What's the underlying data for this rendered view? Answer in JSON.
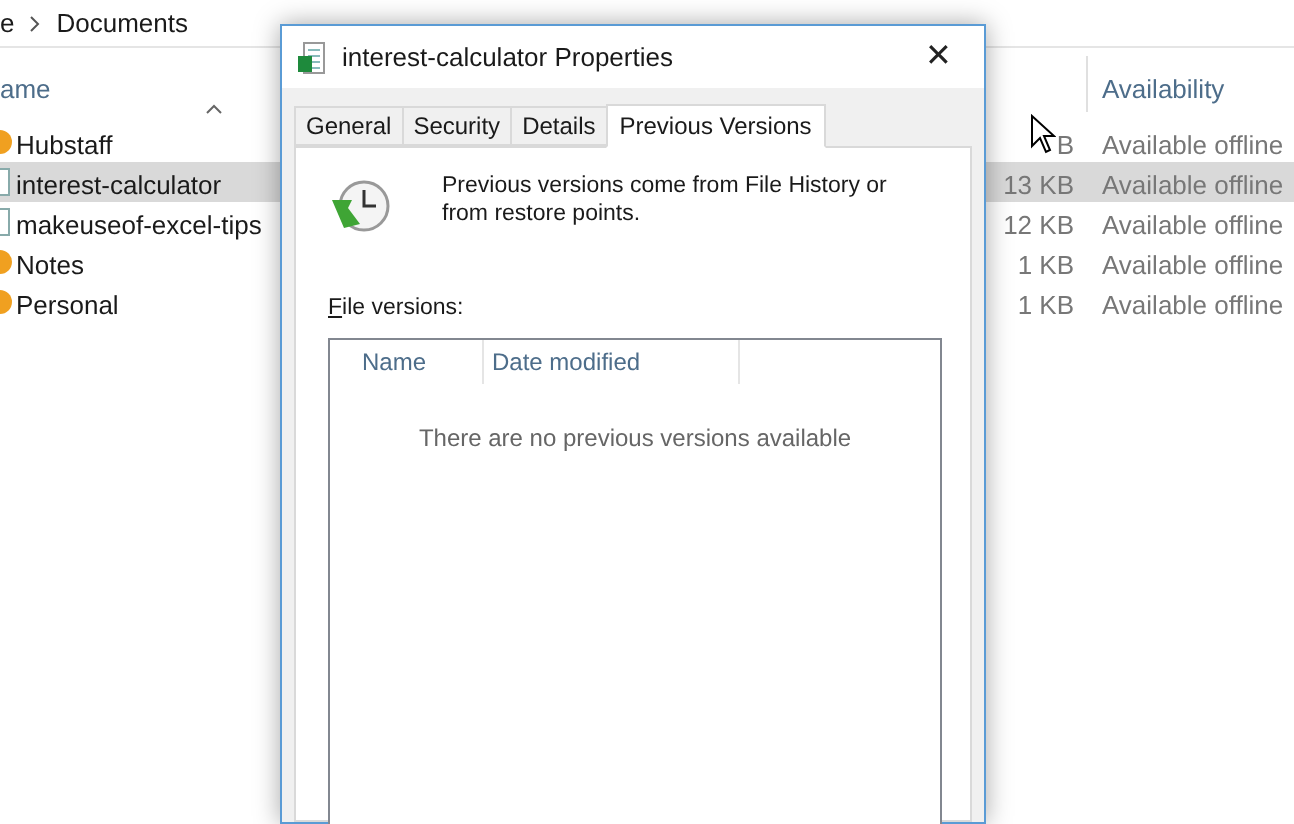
{
  "explorer": {
    "breadcrumb": [
      "e",
      "Documents"
    ],
    "columns": [
      "ame",
      "Availability"
    ],
    "rows": [
      {
        "name": "Hubstaff",
        "kind": "folder",
        "size": "",
        "availability": "Available offline",
        "selected": false
      },
      {
        "name": "interest-calculator",
        "kind": "file",
        "size": "13 KB",
        "availability": "Available offline",
        "selected": true
      },
      {
        "name": "makeuseof-excel-tips",
        "kind": "file",
        "size": "12 KB",
        "availability": "Available offline",
        "selected": false
      },
      {
        "name": "Notes",
        "kind": "folder",
        "size": "1 KB",
        "availability": "Available offline",
        "selected": false
      },
      {
        "name": "Personal",
        "kind": "folder",
        "size": "1 KB",
        "availability": "Available offline",
        "selected": false
      }
    ],
    "partial_size": "B"
  },
  "dialog": {
    "title": "interest-calculator Properties",
    "close": "✕",
    "tabs": [
      {
        "label": "General",
        "selected": false
      },
      {
        "label": "Security",
        "selected": false
      },
      {
        "label": "Details",
        "selected": false
      },
      {
        "label": "Previous Versions",
        "selected": true
      }
    ],
    "info": "Previous versions come from File History or from restore points.",
    "list_label_access": "F",
    "list_label_rest": "ile versions:",
    "list_columns": [
      "Name",
      "Date modified"
    ],
    "empty_message": "There are no previous versions available"
  }
}
